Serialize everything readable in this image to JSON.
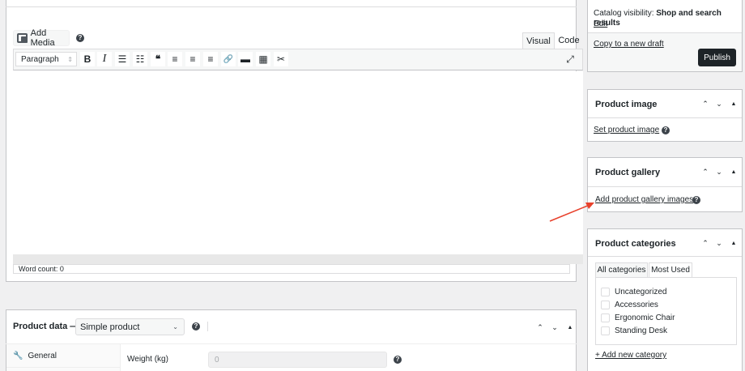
{
  "editor": {
    "add_media_label": "Add Media",
    "help_glyph": "?",
    "tabs": {
      "visual": "Visual",
      "code": "Code"
    },
    "format_select": "Paragraph",
    "toolbar_icons": [
      "bold-icon",
      "italic-icon",
      "bullet-list-icon",
      "numbered-list-icon",
      "blockquote-icon",
      "align-left-icon",
      "align-center-icon",
      "align-right-icon",
      "link-icon",
      "read-more-icon",
      "toolbar-toggle-icon",
      "scissors-icon"
    ],
    "toolbar_glyphs": {
      "bold": "B",
      "italic": "I",
      "bullet": "☰",
      "numbered": "☷",
      "quote": "❝",
      "align_left": "≡",
      "align_center": "≡",
      "align_right": "≡",
      "link": "🔗",
      "more": "▬",
      "kitchen": "▦",
      "scissors": "✂",
      "fullscreen": "⤢"
    },
    "word_count": "Word count: 0"
  },
  "product_data": {
    "title": "Product data —",
    "type_select": "Simple product",
    "tabs": [
      {
        "label": "General",
        "icon": "wrench-icon"
      }
    ],
    "fields": {
      "weight_label": "Weight (kg)",
      "weight_placeholder": "0"
    }
  },
  "publish": {
    "catalog_label": "Catalog visibility:",
    "catalog_value": "Shop and search results",
    "edit_link": "Edit",
    "copy_link": "Copy to a new draft",
    "publish_button": "Publish"
  },
  "product_image": {
    "title": "Product image",
    "link": "Set product image"
  },
  "product_gallery": {
    "title": "Product gallery",
    "link": "Add product gallery images"
  },
  "product_categories": {
    "title": "Product categories",
    "tab_all": "All categories",
    "tab_most": "Most Used",
    "items": [
      "Uncategorized",
      "Accessories",
      "Ergonomic Chair",
      "Standing Desk"
    ],
    "add_link": "+ Add new category"
  },
  "box_controls": {
    "up": "⌃",
    "down": "⌄",
    "toggle": "▲"
  },
  "colors": {
    "annotation_arrow": "#e8412c",
    "dark_button": "#1d2327"
  }
}
